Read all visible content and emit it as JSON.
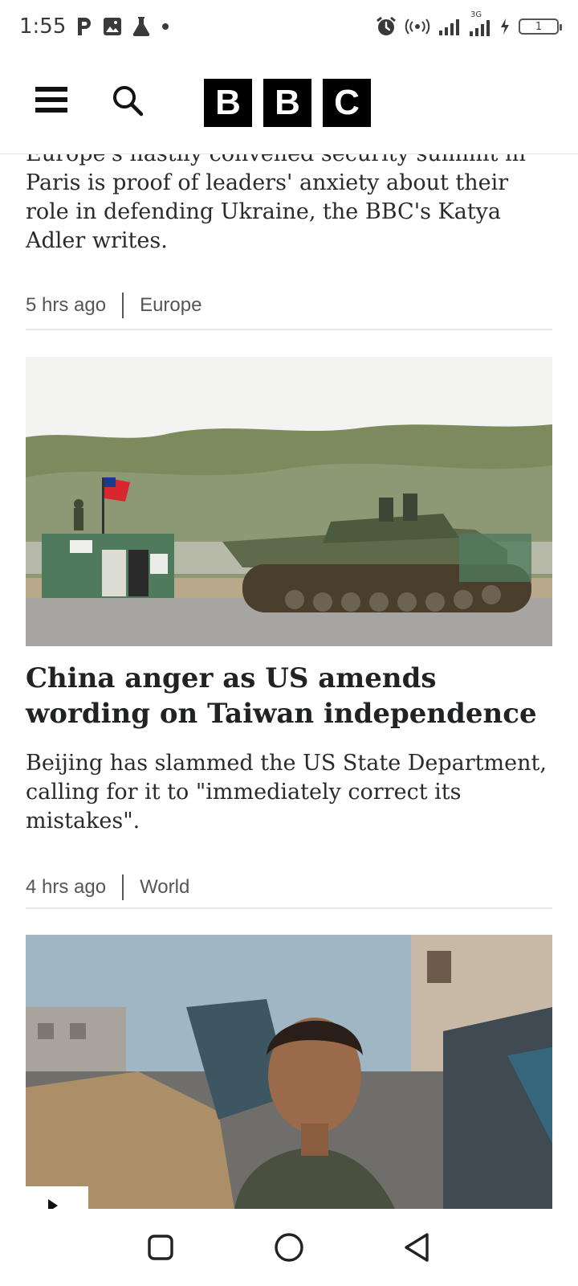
{
  "status_bar": {
    "time": "1:55",
    "left_icons": [
      "parking-p-icon",
      "image-icon",
      "flask-icon",
      "dot-icon"
    ],
    "right_icons": [
      "alarm-icon",
      "hotspot-icon",
      "signal-icon",
      "signal-3g-icon",
      "charging-icon"
    ],
    "battery_level": "1",
    "network_badge": "3G"
  },
  "header": {
    "logo_letters": [
      "B",
      "B",
      "C"
    ]
  },
  "articles": [
    {
      "summary_cut_top": "Europe's hastily convened security summit in",
      "summary": "Paris is proof of leaders' anxiety about their role in defending Ukraine, the BBC's Katya Adler writes.",
      "time": "5 hrs ago",
      "section": "Europe"
    },
    {
      "headline": "China anger as US amends wording on Taiwan independence",
      "summary": "Beijing has slammed the US State Department, calling for it to \"immediately correct its mistakes\".",
      "time": "4 hrs ago",
      "section": "World"
    }
  ],
  "nav_bar": {
    "buttons": [
      "recents-square-icon",
      "home-circle-icon",
      "back-triangle-icon"
    ]
  },
  "colors": {
    "text": "#202224",
    "meta": "#545658",
    "logo_bg": "#000000"
  }
}
